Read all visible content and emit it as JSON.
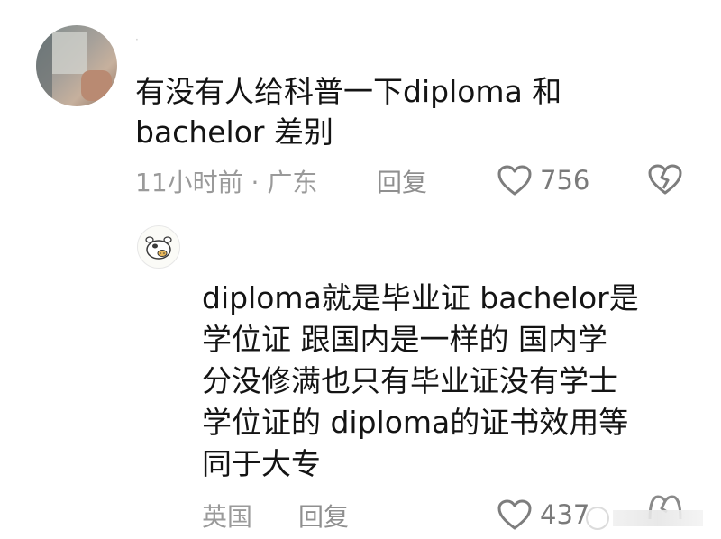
{
  "top_comment": {
    "username_mark": "·",
    "text": "有没有人给科普一下diploma 和\nbachelor 差别",
    "time_location": "11小时前 · 广东",
    "reply_label": "回复",
    "likes": "756"
  },
  "reply_comment": {
    "text": "diploma就是毕业证 bachelor是\n学位证 跟国内是一样的 国内学\n分没修满也只有毕业证没有学士\n学位证的 diploma的证书效用等\n同于大专",
    "location": "英国",
    "reply_label": "回复",
    "likes": "437"
  },
  "icons": {
    "like": "heart-outline-icon",
    "dislike": "broken-heart-icon"
  },
  "colors": {
    "text": "#141414",
    "meta": "#9a9a9a",
    "icon": "#808080"
  }
}
